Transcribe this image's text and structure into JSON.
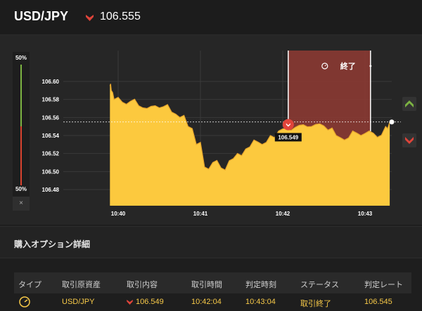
{
  "header": {
    "pair": "USD/JPY",
    "price": "106.555"
  },
  "gauge": {
    "top_label": "50%",
    "bottom_label": "50%",
    "close_label": "×"
  },
  "chart_data": {
    "type": "area",
    "yticks": [
      "106.60",
      "106.58",
      "106.56",
      "106.54",
      "106.52",
      "106.50",
      "106.48"
    ],
    "ylim": [
      106.47,
      106.615
    ],
    "xticks": [
      "10:40",
      "10:41",
      "10:42",
      "10:43"
    ],
    "x": [
      "10:39:54",
      "10:39:55",
      "10:39:57",
      "10:40:03",
      "10:40:09",
      "10:40:15",
      "10:40:21",
      "10:40:27",
      "10:40:33",
      "10:40:39",
      "10:40:45",
      "10:40:51",
      "10:40:57",
      "10:41:03",
      "10:41:09",
      "10:41:15",
      "10:41:21",
      "10:41:27",
      "10:41:33",
      "10:41:39",
      "10:41:45",
      "10:41:51",
      "10:41:57",
      "10:42:03",
      "10:42:09",
      "10:42:15",
      "10:42:21",
      "10:42:27",
      "10:42:33",
      "10:42:39",
      "10:42:45",
      "10:42:51",
      "10:42:57",
      "10:43:03",
      "10:43:09",
      "10:43:15",
      "10:43:18"
    ],
    "values": [
      106.595,
      106.59,
      106.58,
      106.577,
      106.578,
      106.573,
      106.57,
      106.573,
      106.572,
      106.566,
      106.56,
      106.55,
      106.53,
      106.505,
      106.51,
      106.504,
      106.512,
      106.52,
      106.525,
      106.535,
      106.53,
      106.54,
      106.545,
      106.548,
      106.549,
      106.552,
      106.55,
      106.553,
      106.546,
      106.54,
      106.535,
      106.545,
      106.54,
      106.545,
      106.538,
      106.55,
      106.555
    ],
    "current_rate": "106.555",
    "entry_marker": {
      "x": "10:42:04",
      "value": 106.549,
      "label": "106.549"
    },
    "window": {
      "start": "10:42:04",
      "end": "10:43:04",
      "label": "終了"
    },
    "colors": {
      "fill": "#fcc93e",
      "window": "#8b3a33",
      "down": "#e0443a",
      "up": "#7cb342"
    }
  },
  "details": {
    "title": "購入オプション詳細"
  },
  "table": {
    "headers": [
      "タイプ",
      "取引原資産",
      "取引内容",
      "取引時間",
      "判定時刻",
      "ステータス",
      "判定レート"
    ],
    "row": {
      "type_icon": "clock-icon",
      "asset": "USD/JPY",
      "content": "106.549",
      "trade_time": "10:42:04",
      "judge_time": "10:43:04",
      "status": "取引終了",
      "rate": "106.545"
    }
  }
}
